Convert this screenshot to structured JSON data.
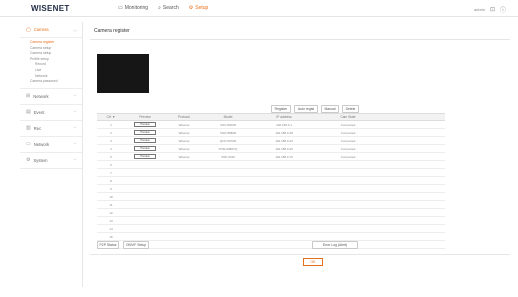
{
  "header": {
    "logo": "WISENET",
    "nav": [
      {
        "label": "Monitoring",
        "icon": "monitor-icon"
      },
      {
        "label": "Search",
        "icon": "search-icon"
      },
      {
        "label": "Setup",
        "icon": "gear-icon",
        "active": true
      }
    ],
    "user": "admin",
    "accent_color": "#e8701a"
  },
  "sidebar": {
    "groups": [
      {
        "label": "Camera",
        "icon": "camera-icon",
        "active": true
      },
      {
        "label": "Network",
        "icon": "network-icon"
      },
      {
        "label": "Event",
        "icon": "event-icon"
      },
      {
        "label": "Rec",
        "icon": "rec-icon"
      },
      {
        "label": "Network",
        "icon": "globe-icon"
      },
      {
        "label": "System",
        "icon": "system-icon"
      }
    ],
    "camera_sub": [
      {
        "label": "Camera register",
        "active": true
      },
      {
        "label": "Camera setup"
      },
      {
        "label": "Camera setup"
      },
      {
        "label": "Profile setup"
      },
      {
        "label": "Record",
        "deep": true
      },
      {
        "label": "Live",
        "deep": true
      },
      {
        "label": "Network",
        "deep": true
      },
      {
        "label": "Camera password"
      }
    ]
  },
  "main": {
    "title": "Camera register",
    "buttons": {
      "register": "Register",
      "auto_regist": "Auto regist",
      "manual": "Manual",
      "delete": "Delete",
      "p2p_status": "P2P Status",
      "onvif_setup": "ONVIF Setup",
      "error_log": "Error Log (Alert)"
    },
    "table": {
      "headers": [
        "CH ▼",
        "Preview",
        "Protocol",
        "Model",
        "IP address",
        "Cam State"
      ],
      "rows": [
        {
          "ch": "1",
          "preview": "Preview",
          "protocol": "Wisenet",
          "model": "XNV-8020R",
          "ip": "192.168.0.1",
          "state": "Connected"
        },
        {
          "ch": "2",
          "preview": "Preview",
          "protocol": "Wisenet",
          "model": "XNO-8080R",
          "ip": "192.168.0.48",
          "state": "Connected"
        },
        {
          "ch": "3",
          "preview": "Preview",
          "protocol": "Wisenet",
          "model": "QNV-6070R",
          "ip": "192.168.0.43",
          "state": "Connected"
        },
        {
          "ch": "4",
          "preview": "Preview",
          "protocol": "Wisenet",
          "model": "PNM-9080VQ",
          "ip": "192.168.0.46",
          "state": "Connected"
        },
        {
          "ch": "5",
          "preview": "Preview",
          "protocol": "Wisenet",
          "model": "XNP-6320",
          "ip": "192.168.0.15",
          "state": "Connected"
        },
        {
          "ch": "6"
        },
        {
          "ch": "7"
        },
        {
          "ch": "8"
        },
        {
          "ch": "9"
        },
        {
          "ch": "10"
        },
        {
          "ch": "11"
        },
        {
          "ch": "12"
        },
        {
          "ch": "13"
        },
        {
          "ch": "14"
        },
        {
          "ch": "15"
        },
        {
          "ch": "16"
        }
      ]
    },
    "ok_label": "OK"
  }
}
